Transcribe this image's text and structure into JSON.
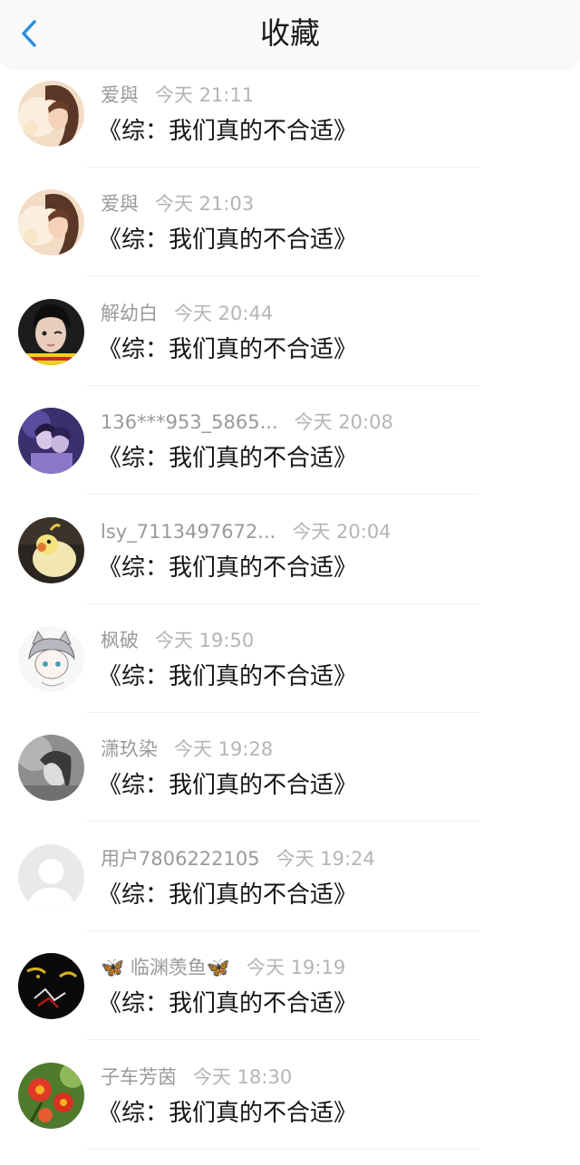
{
  "header": {
    "title": "收藏",
    "back_icon": "chevron-left-icon",
    "accent": "#2b8fe0"
  },
  "items": [
    {
      "user": "爱與",
      "time": "今天 21:11",
      "book": "《综：我们真的不合适》",
      "avatar": "girl-portrait-warm"
    },
    {
      "user": "爱與",
      "time": "今天 21:03",
      "book": "《综：我们真的不合适》",
      "avatar": "girl-portrait-warm"
    },
    {
      "user": "解幼白",
      "time": "今天 20:44",
      "book": "《综：我们真的不合适》",
      "avatar": "girl-photo-dark-hair"
    },
    {
      "user": "136***953_5865...",
      "time": "今天 20:08",
      "book": "《综：我们真的不合适》",
      "avatar": "anime-couple-purple"
    },
    {
      "user": "lsy_7113497672...",
      "time": "今天 20:04",
      "book": "《综：我们真的不合适》",
      "avatar": "cockatiel-bird"
    },
    {
      "user": "枫破",
      "time": "今天 19:50",
      "book": "《综：我们真的不合适》",
      "avatar": "anime-cat-ear-sketch"
    },
    {
      "user": "潇玖染",
      "time": "今天 19:28",
      "book": "《综：我们真的不合适》",
      "avatar": "grey-ink-portrait"
    },
    {
      "user": "用户7806222105",
      "time": "今天 19:24",
      "book": "《综：我们真的不合适》",
      "avatar": "default-user-silhouette"
    },
    {
      "user": "🦋 临渊羡鱼🦋",
      "time": "今天 19:19",
      "book": "《综：我们真的不合适》",
      "avatar": "dark-hands-art"
    },
    {
      "user": "子车芳茵",
      "time": "今天 18:30",
      "book": "《综：我们真的不合适》",
      "avatar": "red-flowers"
    }
  ]
}
